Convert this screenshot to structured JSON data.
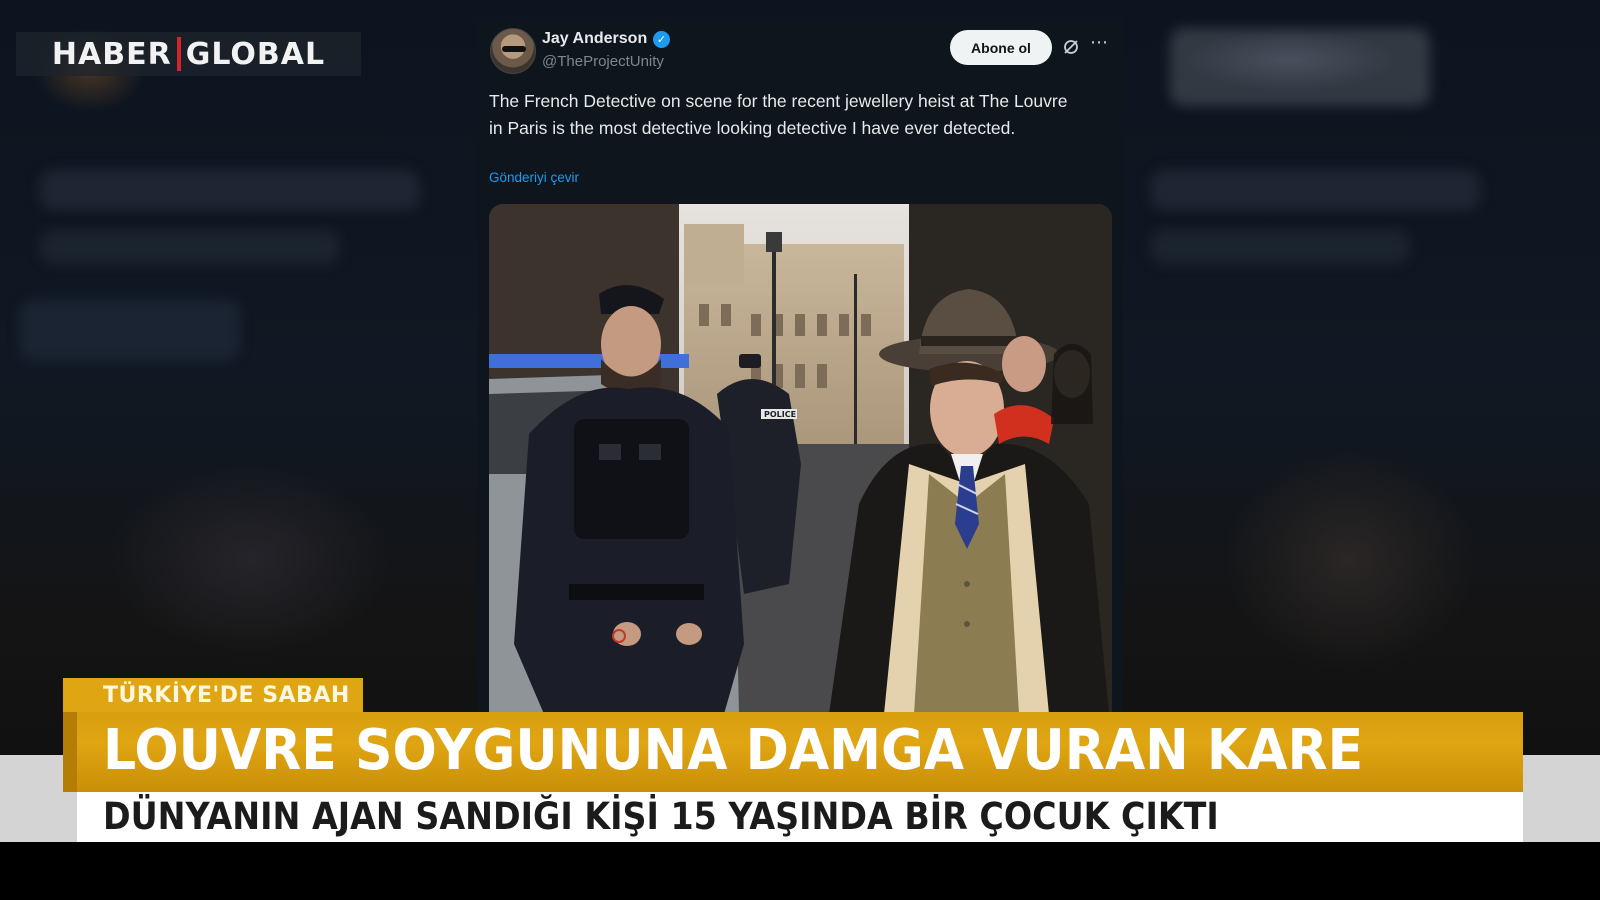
{
  "channel": {
    "logo_left": "HABER",
    "logo_right": "GLOBAL",
    "accent_color": "#d4252b"
  },
  "tweet": {
    "author_name": "Jay Anderson",
    "author_handle": "@TheProjectUnity",
    "verified": true,
    "follow_label": "Abone ol",
    "more_icon": "⋯",
    "text": "The French Detective on scene for the recent jewellery heist at The Louvre in Paris is the most detective looking detective I have ever detected.",
    "translate_label": "Gönderiyi çevir",
    "link_color": "#1d9bf0",
    "photo_signage": "POLICE"
  },
  "lower_third": {
    "program": "TÜRKİYE'DE SABAH",
    "headline": "LOUVRE SOYGUNUNA DAMGA VURAN KARE",
    "subheadline": "DÜNYANIN AJAN SANDIĞI KİŞİ 15 YAŞINDA BİR ÇOCUK ÇIKTI",
    "accent_color": "#e0a512"
  }
}
